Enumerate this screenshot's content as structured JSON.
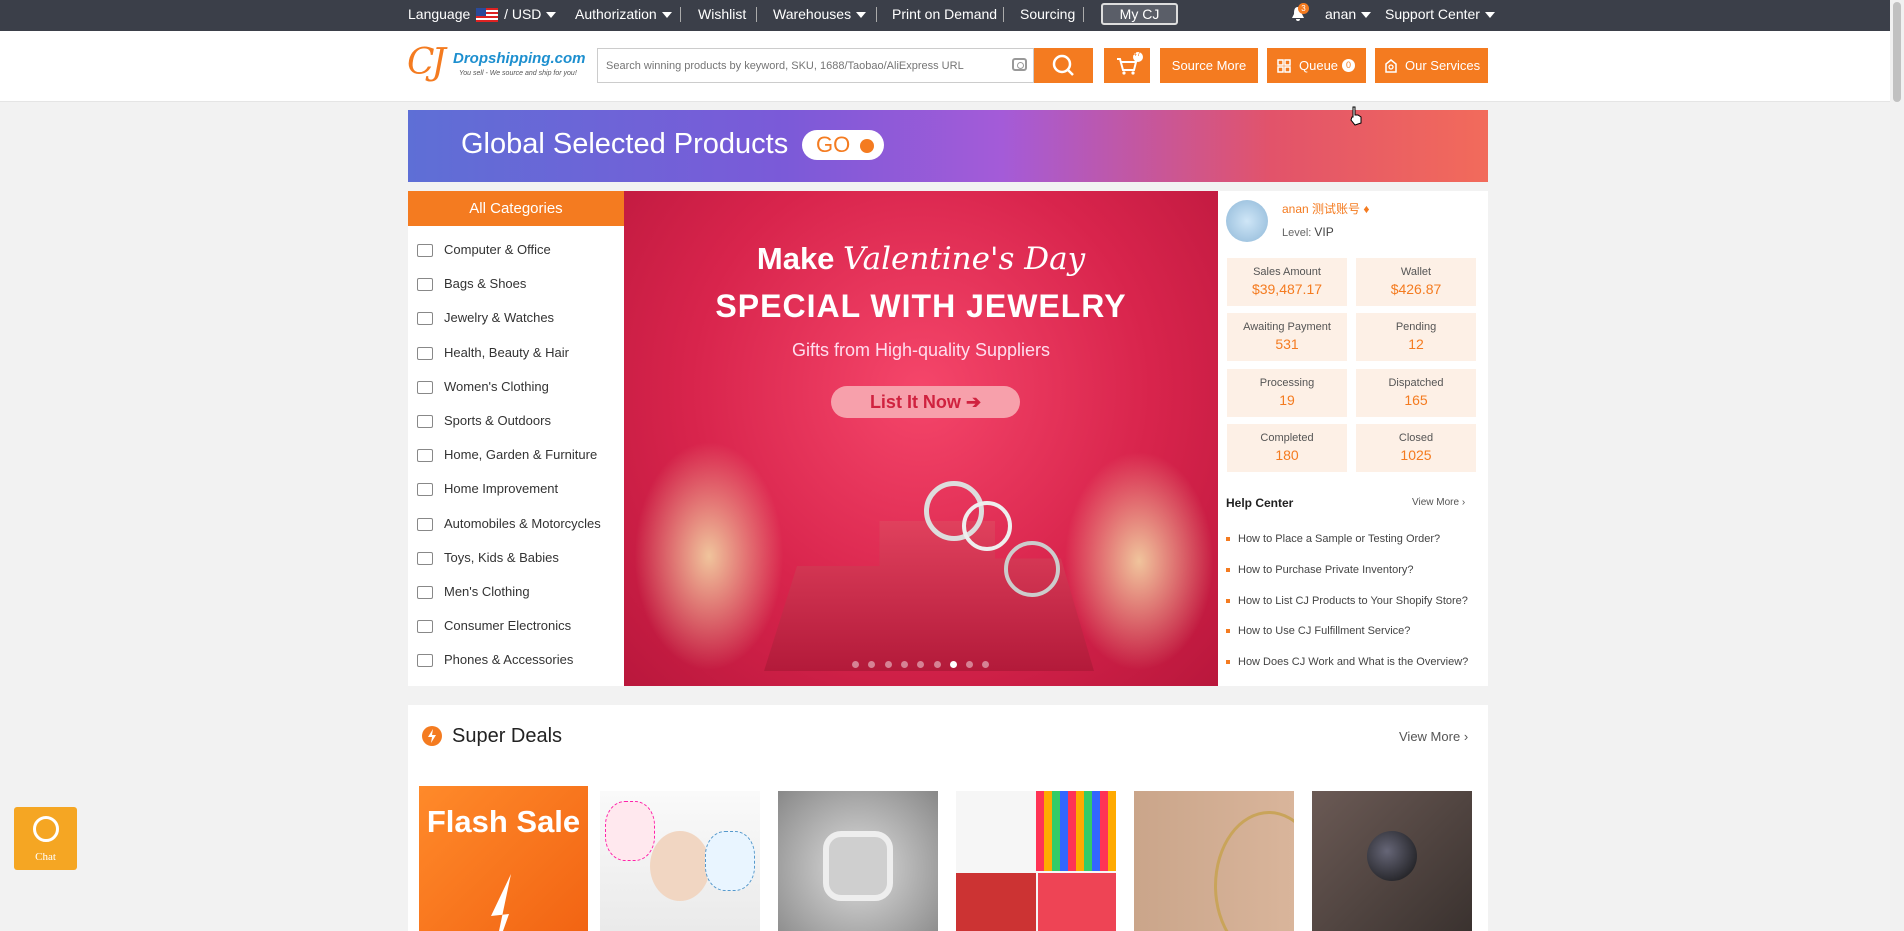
{
  "topbar": {
    "language_label": "Language",
    "currency": "/ USD",
    "authorization": "Authorization",
    "wishlist": "Wishlist",
    "warehouses": "Warehouses",
    "print_on_demand": "Print on Demand",
    "sourcing": "Sourcing",
    "my_cj": "My CJ",
    "notification_count": "3",
    "user": "anan",
    "support_center": "Support Center"
  },
  "header": {
    "logo_mark": "CJ",
    "logo_text": "Dropshipping.com",
    "logo_tagline": "You sell - We source and ship for you!",
    "search_placeholder": "Search winning products by keyword, SKU, 1688/Taobao/AliExpress URL",
    "cart_count": "47",
    "source_more": "Source More",
    "queue": "Queue",
    "queue_count": "0",
    "our_services": "Our Services"
  },
  "promo_banner": {
    "title": "Global Selected Products",
    "go_label": "GO"
  },
  "categories": {
    "header": "All Categories",
    "items": [
      {
        "label": "Computer & Office",
        "icon": "computer-icon"
      },
      {
        "label": "Bags & Shoes",
        "icon": "bag-icon"
      },
      {
        "label": "Jewelry & Watches",
        "icon": "watch-icon"
      },
      {
        "label": "Health, Beauty & Hair",
        "icon": "brush-icon"
      },
      {
        "label": "Women's Clothing",
        "icon": "dress-icon"
      },
      {
        "label": "Sports & Outdoors",
        "icon": "sports-icon"
      },
      {
        "label": "Home, Garden & Furniture",
        "icon": "sofa-icon"
      },
      {
        "label": "Home Improvement",
        "icon": "paint-roller-icon"
      },
      {
        "label": "Automobiles & Motorcycles",
        "icon": "motorcycle-icon"
      },
      {
        "label": "Toys, Kids & Babies",
        "icon": "stroller-icon"
      },
      {
        "label": "Men's Clothing",
        "icon": "shirt-icon"
      },
      {
        "label": "Consumer Electronics",
        "icon": "headphones-icon"
      },
      {
        "label": "Phones & Accessories",
        "icon": "phone-icon"
      }
    ]
  },
  "hero": {
    "line1_a": "Make ",
    "line1_b": "Valentine's Day",
    "line2": "SPECIAL WITH JEWELRY",
    "line3": "Gifts from High-quality Suppliers",
    "cta": "List It Now",
    "slide_count": 9,
    "active_slide": 7
  },
  "account": {
    "name": "anan 测试账号",
    "level_label": "Level:",
    "level": "VIP",
    "stats": [
      {
        "label": "Sales Amount",
        "value": "$39,487.17"
      },
      {
        "label": "Wallet",
        "value": "$426.87"
      },
      {
        "label": "Awaiting Payment",
        "value": "531"
      },
      {
        "label": "Pending",
        "value": "12"
      },
      {
        "label": "Processing",
        "value": "19"
      },
      {
        "label": "Dispatched",
        "value": "165"
      },
      {
        "label": "Completed",
        "value": "180"
      },
      {
        "label": "Closed",
        "value": "1025"
      }
    ]
  },
  "help_center": {
    "title": "Help Center",
    "view_more": "View More",
    "items": [
      "How to Place a Sample or Testing Order?",
      "How to Purchase Private Inventory?",
      "How to List CJ Products to Your Shopify Store?",
      "How to Use CJ Fulfillment Service?",
      "How Does CJ Work and What is the Overview?"
    ]
  },
  "super_deals": {
    "title": "Super Deals",
    "view_more": "View More",
    "flash_sale": "Flash Sale"
  },
  "chat": {
    "label": "Chat"
  },
  "colors": {
    "accent": "#f47b20",
    "topbar": "#3b3f49"
  }
}
